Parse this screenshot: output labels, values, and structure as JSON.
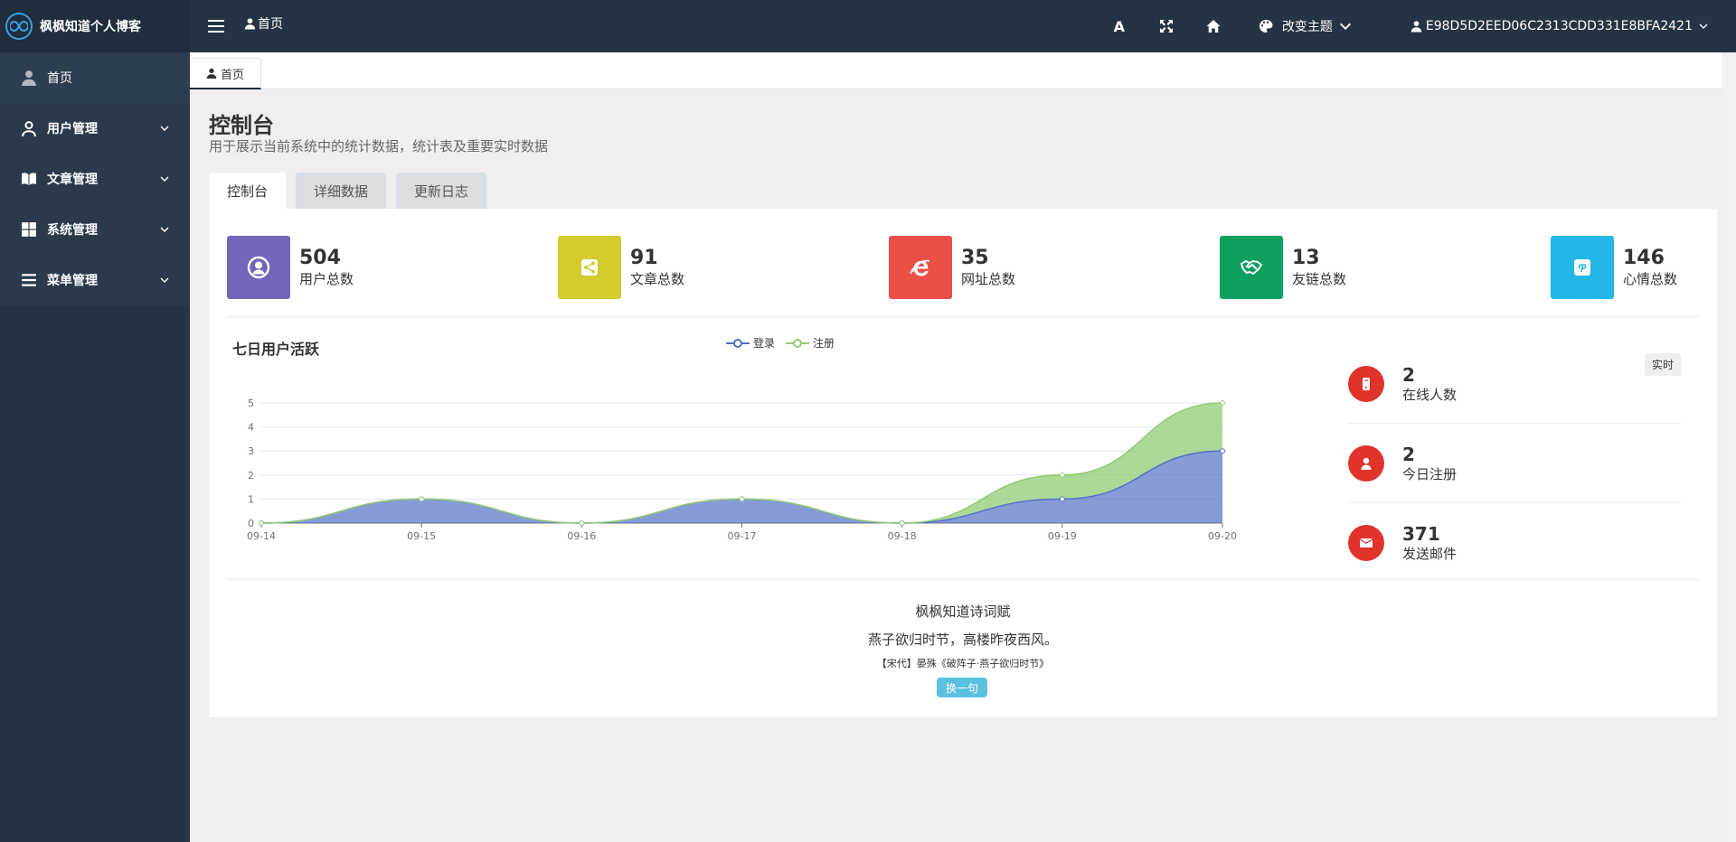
{
  "brand": {
    "title": "枫枫知道个人博客"
  },
  "sidebar": {
    "items": [
      {
        "label": "首页"
      },
      {
        "label": "用户管理"
      },
      {
        "label": "文章管理"
      },
      {
        "label": "系统管理"
      },
      {
        "label": "菜单管理"
      }
    ]
  },
  "header": {
    "home_label": "首页",
    "theme_label": "改变主题",
    "user_label": "E98D5D2EED06C2313CDD331E8BFA2421",
    "font_icon_glyph": "A"
  },
  "tabbar": {
    "active_tab": "首页"
  },
  "page": {
    "title": "控制台",
    "description": "用于展示当前系统中的统计数据，统计表及重要实时数据",
    "tabs": [
      "控制台",
      "详细数据",
      "更新日志"
    ]
  },
  "stats": [
    {
      "value": "504",
      "label": "用户总数",
      "color": "#7266ba",
      "icon": "user-circle-icon"
    },
    {
      "value": "91",
      "label": "文章总数",
      "color": "#d3cb2e",
      "icon": "share-icon"
    },
    {
      "value": "35",
      "label": "网址总数",
      "color": "#ea4f48",
      "icon": "ie-icon"
    },
    {
      "value": "13",
      "label": "友链总数",
      "color": "#0e9f5f",
      "icon": "handshake-icon"
    },
    {
      "value": "146",
      "label": "心情总数",
      "color": "#23b7e5",
      "icon": "pinterest-icon"
    }
  ],
  "chart_data": {
    "type": "area",
    "title": "七日用户活跃",
    "categories": [
      "09-14",
      "09-15",
      "09-16",
      "09-17",
      "09-18",
      "09-19",
      "09-20"
    ],
    "series": [
      {
        "name": "登录",
        "values": [
          0,
          1,
          0,
          1,
          0,
          1,
          3
        ],
        "color": "#5470c6"
      },
      {
        "name": "注册",
        "values": [
          0,
          0,
          0,
          0,
          0,
          1,
          2
        ],
        "color": "#91cc75"
      }
    ],
    "stacked": true,
    "ylim": [
      0,
      5
    ],
    "yticks": [
      0,
      1,
      2,
      3,
      4,
      5
    ],
    "legend": "top-center",
    "grid": true
  },
  "realtime": {
    "badge": "实时",
    "items": [
      {
        "value": "2",
        "label": "在线人数",
        "icon": "mobile-icon"
      },
      {
        "value": "2",
        "label": "今日注册",
        "icon": "user-icon"
      },
      {
        "value": "371",
        "label": "发送邮件",
        "icon": "envelope-icon"
      }
    ]
  },
  "poem": {
    "title": "枫枫知道诗词赋",
    "line": "燕子欲归时节，高楼昨夜西风。",
    "source": "【宋代】晏殊《破阵子·燕子欲归时节》",
    "button": "换一句"
  }
}
